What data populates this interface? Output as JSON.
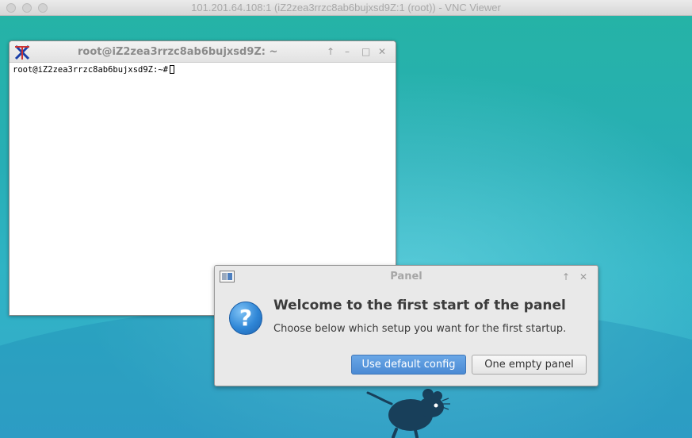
{
  "vnc_window": {
    "title": "101.201.64.108:1 (iZ2zea3rrzc8ab6bujxsd9Z:1 (root)) - VNC Viewer"
  },
  "terminal": {
    "title": "root@iZ2zea3rrzc8ab6bujxsd9Z: ~",
    "prompt": "root@iZ2zea3rrzc8ab6bujxsd9Z:~#",
    "controls": {
      "up": "↑",
      "minimize": "–",
      "maximize": "□",
      "close": "✕"
    }
  },
  "panel_dialog": {
    "title": "Panel",
    "heading": "Welcome to the first start of the panel",
    "message": "Choose below which setup you want for the first startup.",
    "question_mark": "?",
    "default_button": "Use default config",
    "empty_button": "One empty panel",
    "controls": {
      "up": "↑",
      "close": "✕"
    }
  },
  "colors": {
    "accent_button": "#4a8ad4",
    "desktop": "#2aa8b4",
    "mouse_logo": "#183f5a"
  }
}
